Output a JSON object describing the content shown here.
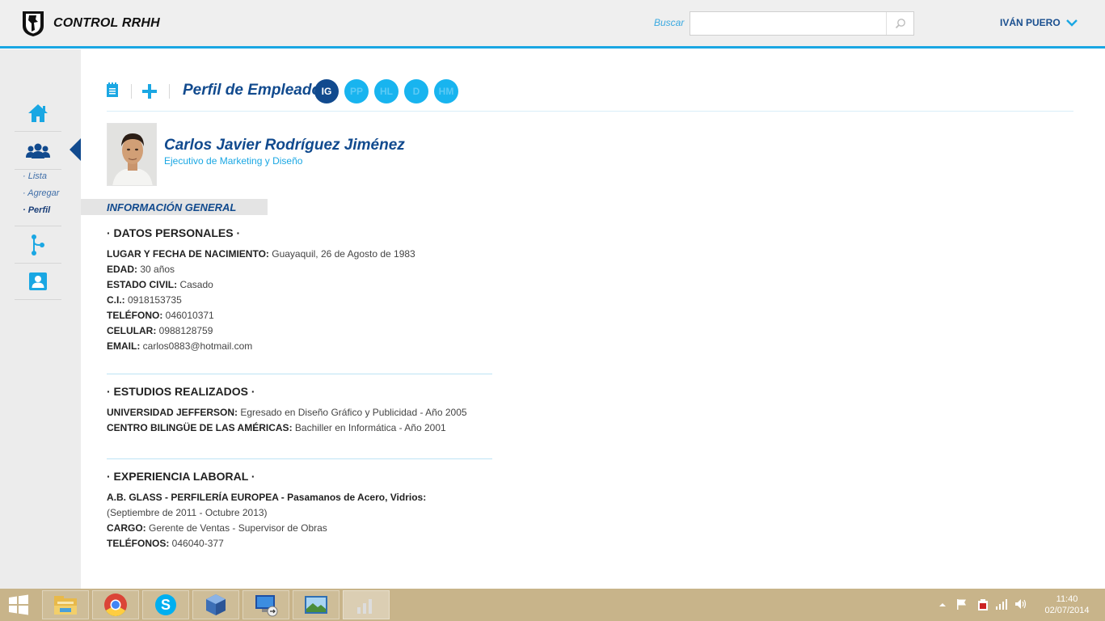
{
  "header": {
    "app_title": "CONTROL RRHH",
    "search_label": "Buscar",
    "search_value": "",
    "user_name": "IVÁN PUERO"
  },
  "sidebar": {
    "items": [
      {
        "icon": "home-icon"
      },
      {
        "icon": "users-icon"
      },
      {
        "icon": "org-chart-icon"
      },
      {
        "icon": "contact-card-icon"
      }
    ],
    "sub_links": [
      "· Lista",
      "· Agregar",
      "· Perfil"
    ],
    "active_sub": "· Perfil"
  },
  "toolbar": {
    "page_title": "Perfil de Empleado",
    "tabs": [
      {
        "label": "IG",
        "active": true
      },
      {
        "label": "PP",
        "active": false
      },
      {
        "label": "HL",
        "active": false
      },
      {
        "label": "D",
        "active": false
      },
      {
        "label": "HM",
        "active": false
      }
    ]
  },
  "employee": {
    "name": "Carlos Javier Rodríguez Jiménez",
    "role": "Ejecutivo de Marketing y Diseño"
  },
  "general_section_title": "INFORMACIÓN GENERAL",
  "personal": {
    "title": "· DATOS PERSONALES ·",
    "rows": [
      {
        "label": "LUGAR Y FECHA DE NACIMIENTO:",
        "value": " Guayaquil, 26 de Agosto de 1983"
      },
      {
        "label": "EDAD:",
        "value": " 30 años"
      },
      {
        "label": "ESTADO CIVIL:",
        "value": " Casado"
      },
      {
        "label": "C.I.:",
        "value": " 0918153735"
      },
      {
        "label": "TELÉFONO:",
        "value": " 046010371"
      },
      {
        "label": "CELULAR:",
        "value": " 0988128759"
      },
      {
        "label": "EMAIL:",
        "value": " carlos0883@hotmail.com"
      }
    ]
  },
  "studies": {
    "title": "· ESTUDIOS REALIZADOS ·",
    "rows": [
      {
        "label": "UNIVERSIDAD JEFFERSON:",
        "value": " Egresado en Diseño Gráfico y Publicidad - Año 2005"
      },
      {
        "label": "CENTRO BILINGÜE DE LAS AMÉRICAS:",
        "value": " Bachiller en Informática - Año 2001"
      }
    ]
  },
  "experience": {
    "title": "· EXPERIENCIA LABORAL ·",
    "company": "A.B. GLASS - PERFILERÍA EUROPEA - Pasamanos de Acero, Vidrios:",
    "period": "(Septiembre de 2011 -  Octubre 2013)",
    "rows": [
      {
        "label": "CARGO:",
        "value": " Gerente de Ventas - Supervisor de Obras"
      },
      {
        "label": "TELÉFONOS:",
        "value": " 046040-377"
      }
    ]
  },
  "taskbar": {
    "apps": [
      "file-explorer-icon",
      "chrome-icon",
      "skype-icon",
      "virtualbox-icon",
      "remote-desktop-icon",
      "photo-viewer-icon",
      "app-icon"
    ],
    "time": "11:40",
    "date": "02/07/2014"
  },
  "colors": {
    "accent": "#1aa7e3",
    "brand_dark": "#114a8e",
    "taskbar": "#c8b48a"
  }
}
